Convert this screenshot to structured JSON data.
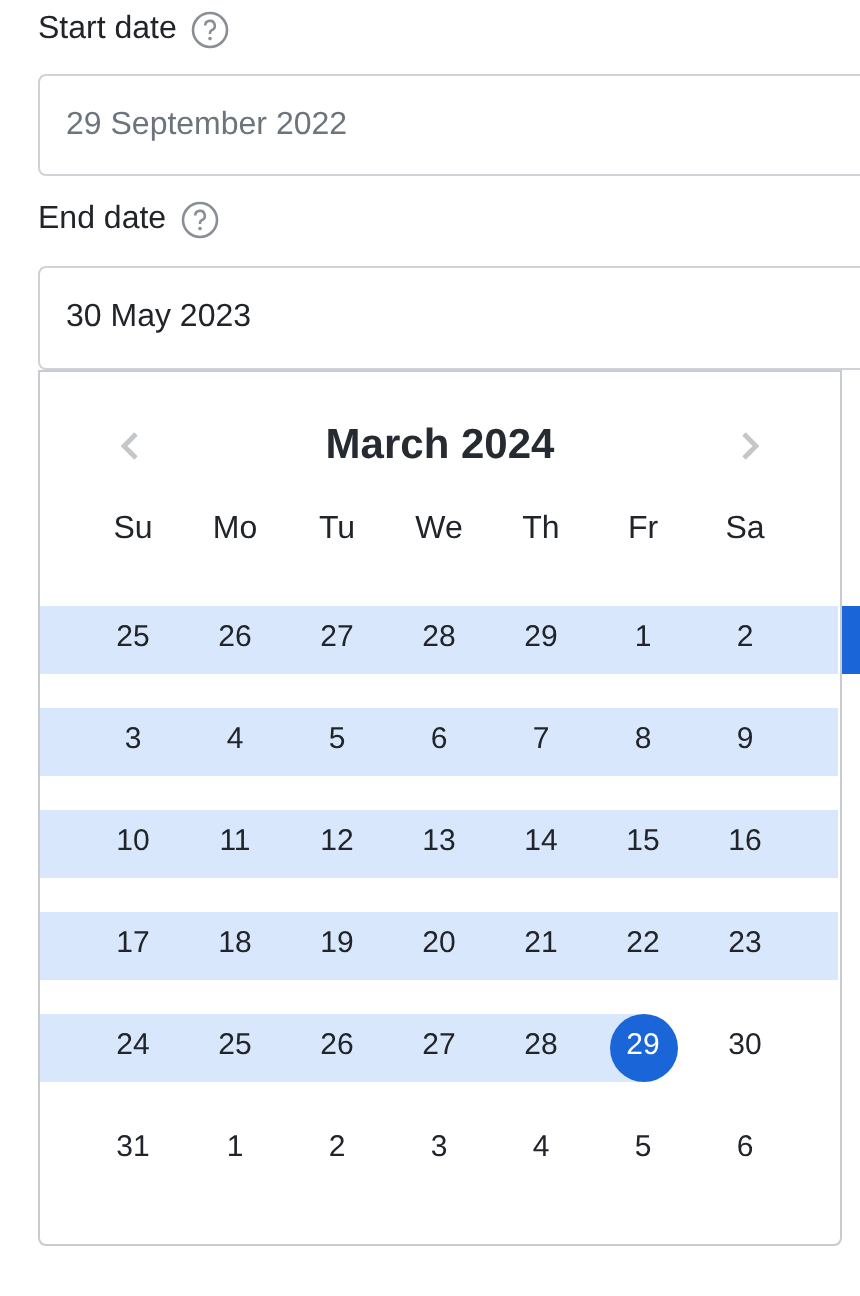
{
  "start_date": {
    "label": "Start date",
    "value": "29 September 2022",
    "disabled": true
  },
  "end_date": {
    "label": "End date",
    "value": "30 May 2023",
    "disabled": false
  },
  "calendar": {
    "title": "March 2024",
    "weekdays": [
      "Su",
      "Mo",
      "Tu",
      "We",
      "Th",
      "Fr",
      "Sa"
    ],
    "weeks": [
      [
        {
          "day": "25",
          "in_range": true,
          "selected": false
        },
        {
          "day": "26",
          "in_range": true,
          "selected": false
        },
        {
          "day": "27",
          "in_range": true,
          "selected": false
        },
        {
          "day": "28",
          "in_range": true,
          "selected": false
        },
        {
          "day": "29",
          "in_range": true,
          "selected": false
        },
        {
          "day": "1",
          "in_range": true,
          "selected": false
        },
        {
          "day": "2",
          "in_range": true,
          "selected": false
        }
      ],
      [
        {
          "day": "3",
          "in_range": true,
          "selected": false
        },
        {
          "day": "4",
          "in_range": true,
          "selected": false
        },
        {
          "day": "5",
          "in_range": true,
          "selected": false
        },
        {
          "day": "6",
          "in_range": true,
          "selected": false
        },
        {
          "day": "7",
          "in_range": true,
          "selected": false
        },
        {
          "day": "8",
          "in_range": true,
          "selected": false
        },
        {
          "day": "9",
          "in_range": true,
          "selected": false
        }
      ],
      [
        {
          "day": "10",
          "in_range": true,
          "selected": false
        },
        {
          "day": "11",
          "in_range": true,
          "selected": false
        },
        {
          "day": "12",
          "in_range": true,
          "selected": false
        },
        {
          "day": "13",
          "in_range": true,
          "selected": false
        },
        {
          "day": "14",
          "in_range": true,
          "selected": false
        },
        {
          "day": "15",
          "in_range": true,
          "selected": false
        },
        {
          "day": "16",
          "in_range": true,
          "selected": false
        }
      ],
      [
        {
          "day": "17",
          "in_range": true,
          "selected": false
        },
        {
          "day": "18",
          "in_range": true,
          "selected": false
        },
        {
          "day": "19",
          "in_range": true,
          "selected": false
        },
        {
          "day": "20",
          "in_range": true,
          "selected": false
        },
        {
          "day": "21",
          "in_range": true,
          "selected": false
        },
        {
          "day": "22",
          "in_range": true,
          "selected": false
        },
        {
          "day": "23",
          "in_range": true,
          "selected": false
        }
      ],
      [
        {
          "day": "24",
          "in_range": true,
          "selected": false
        },
        {
          "day": "25",
          "in_range": true,
          "selected": false
        },
        {
          "day": "26",
          "in_range": true,
          "selected": false
        },
        {
          "day": "27",
          "in_range": true,
          "selected": false
        },
        {
          "day": "28",
          "in_range": true,
          "selected": false
        },
        {
          "day": "29",
          "in_range": true,
          "selected": true
        },
        {
          "day": "30",
          "in_range": false,
          "selected": false
        }
      ],
      [
        {
          "day": "31",
          "in_range": false,
          "selected": false
        },
        {
          "day": "1",
          "in_range": false,
          "selected": false
        },
        {
          "day": "2",
          "in_range": false,
          "selected": false
        },
        {
          "day": "3",
          "in_range": false,
          "selected": false
        },
        {
          "day": "4",
          "in_range": false,
          "selected": false
        },
        {
          "day": "5",
          "in_range": false,
          "selected": false
        },
        {
          "day": "6",
          "in_range": false,
          "selected": false
        }
      ]
    ]
  }
}
